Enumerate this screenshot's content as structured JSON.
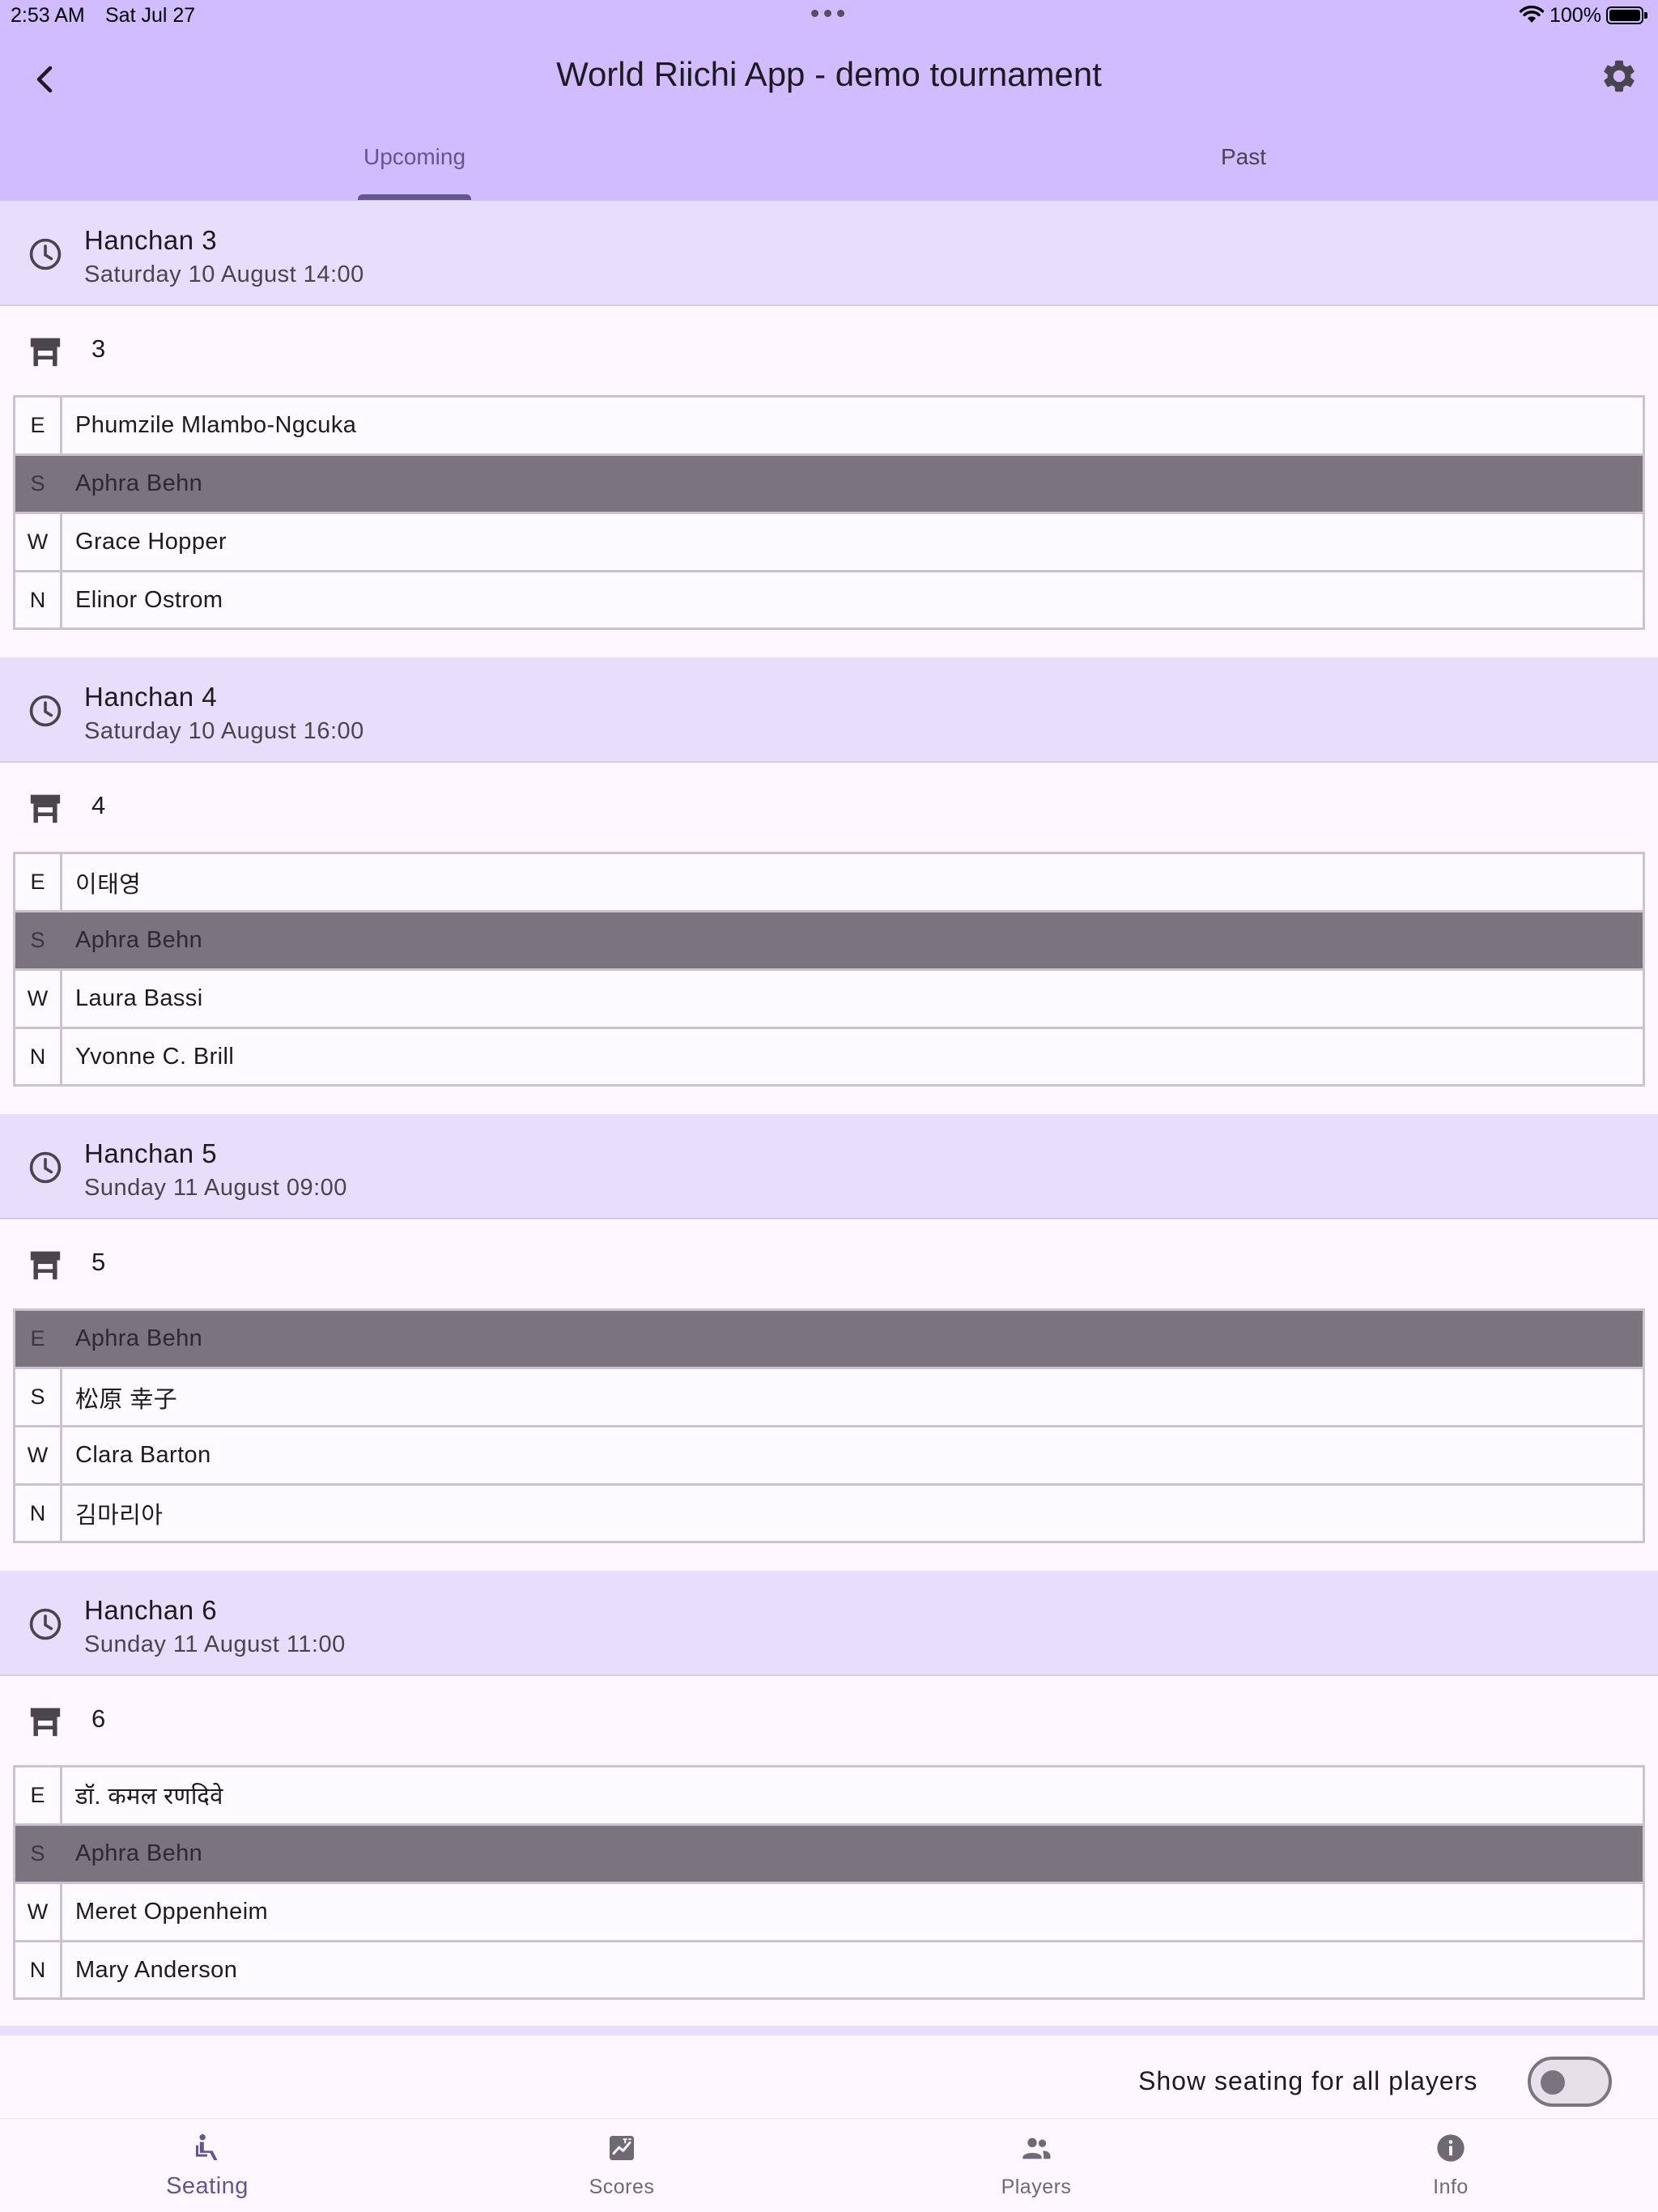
{
  "status_bar": {
    "time": "2:53 AM",
    "date": "Sat Jul 27",
    "battery": "100%"
  },
  "header": {
    "title": "World Riichi App - demo tournament",
    "tabs": [
      {
        "label": "Upcoming",
        "active": true
      },
      {
        "label": "Past",
        "active": false
      }
    ]
  },
  "rounds": [
    {
      "name": "Hanchan 3",
      "time": "Saturday 10 August 14:00",
      "table": "3",
      "seats": [
        {
          "wind": "E",
          "player": "Phumzile Mlambo-Ngcuka",
          "highlighted": false
        },
        {
          "wind": "S",
          "player": "Aphra Behn",
          "highlighted": true
        },
        {
          "wind": "W",
          "player": "Grace Hopper",
          "highlighted": false
        },
        {
          "wind": "N",
          "player": "Elinor Ostrom",
          "highlighted": false
        }
      ]
    },
    {
      "name": "Hanchan 4",
      "time": "Saturday 10 August 16:00",
      "table": "4",
      "seats": [
        {
          "wind": "E",
          "player": "이태영",
          "highlighted": false
        },
        {
          "wind": "S",
          "player": "Aphra Behn",
          "highlighted": true
        },
        {
          "wind": "W",
          "player": "Laura Bassi",
          "highlighted": false
        },
        {
          "wind": "N",
          "player": "Yvonne C. Brill",
          "highlighted": false
        }
      ]
    },
    {
      "name": "Hanchan 5",
      "time": "Sunday 11 August 09:00",
      "table": "5",
      "seats": [
        {
          "wind": "E",
          "player": "Aphra Behn",
          "highlighted": true
        },
        {
          "wind": "S",
          "player": "松原 幸子",
          "highlighted": false
        },
        {
          "wind": "W",
          "player": "Clara Barton",
          "highlighted": false
        },
        {
          "wind": "N",
          "player": "김마리아",
          "highlighted": false
        }
      ]
    },
    {
      "name": "Hanchan 6",
      "time": "Sunday 11 August 11:00",
      "table": "6",
      "seats": [
        {
          "wind": "E",
          "player": "डॉ. कमल रणदिवे",
          "highlighted": false
        },
        {
          "wind": "S",
          "player": "Aphra Behn",
          "highlighted": true
        },
        {
          "wind": "W",
          "player": "Meret Oppenheim",
          "highlighted": false
        },
        {
          "wind": "N",
          "player": "Mary Anderson",
          "highlighted": false
        }
      ]
    }
  ],
  "toggle": {
    "label": "Show seating for all players",
    "on": false
  },
  "bottom_nav": [
    {
      "label": "Seating",
      "icon": "seating-icon",
      "active": true
    },
    {
      "label": "Scores",
      "icon": "scores-icon",
      "active": false
    },
    {
      "label": "Players",
      "icon": "players-icon",
      "active": false
    },
    {
      "label": "Info",
      "icon": "info-icon",
      "active": false
    }
  ],
  "colors": {
    "app_bar": "#d0bcff",
    "accent": "#65558f",
    "round_header": "#e8defb",
    "highlight_row": "#79747e",
    "background": "#fdf7ff"
  }
}
